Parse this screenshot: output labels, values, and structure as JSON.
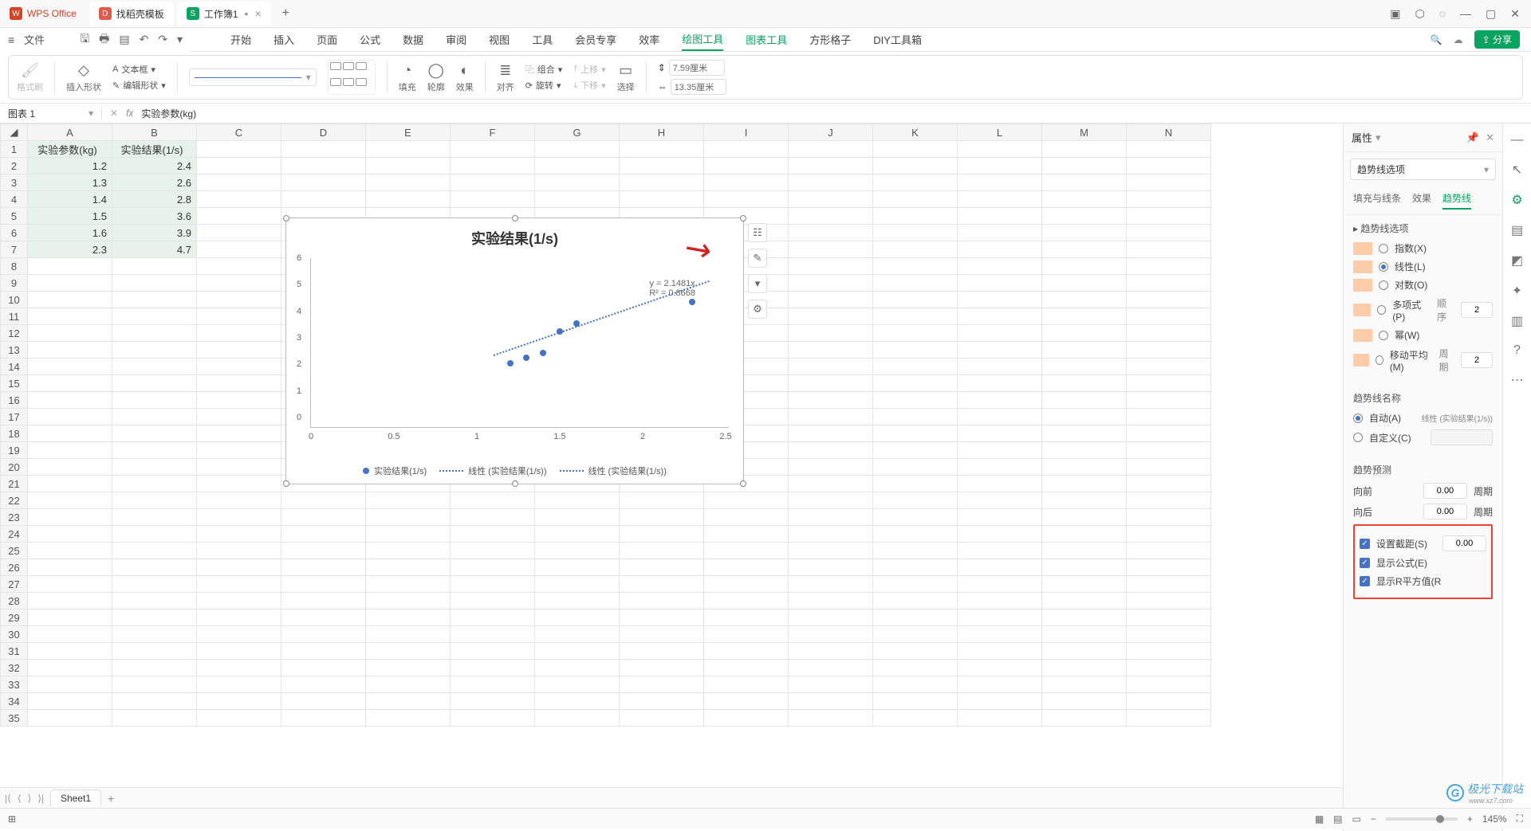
{
  "app": {
    "name": "WPS Office",
    "template_tab": "找稻壳模板",
    "doc_tab": "工作簿1"
  },
  "window_controls": {
    "min": "—",
    "max": "▢",
    "close": "✕"
  },
  "file_menu": "文件",
  "ribbon_tabs": [
    "开始",
    "插入",
    "页面",
    "公式",
    "数据",
    "审阅",
    "视图",
    "工具",
    "会员专享",
    "效率",
    "绘图工具",
    "图表工具",
    "方形格子",
    "DIY工具箱"
  ],
  "ribbon_tabs_active": "绘图工具",
  "ribbon_tabs_special": "图表工具",
  "toolbar": {
    "format_brush": "格式刷",
    "insert_shape": "插入形状",
    "text_box": "文本框",
    "edit_shape": "编辑形状",
    "fill": "填充",
    "outline": "轮廓",
    "effect": "效果",
    "align": "对齐",
    "group": "组合",
    "rotate": "旋转",
    "move_up": "上移",
    "move_down": "下移",
    "select": "选择",
    "width": "7.59厘米",
    "height": "13.35厘米"
  },
  "namebox": "图表 1",
  "formula": "实验参数(kg)",
  "columns": [
    "A",
    "B",
    "C",
    "D",
    "E",
    "F",
    "G",
    "H",
    "I",
    "J",
    "K",
    "L",
    "M",
    "N"
  ],
  "rows_count": 35,
  "data_table": {
    "headers": [
      "实验参数(kg)",
      "实验结果(1/s)"
    ],
    "rows": [
      [
        "1.2",
        "2.4"
      ],
      [
        "1.3",
        "2.6"
      ],
      [
        "1.4",
        "2.8"
      ],
      [
        "1.5",
        "3.6"
      ],
      [
        "1.6",
        "3.9"
      ],
      [
        "2.3",
        "4.7"
      ]
    ]
  },
  "chart_data": {
    "type": "scatter",
    "title": "实验结果(1/s)",
    "x": [
      1.2,
      1.3,
      1.4,
      1.5,
      1.6,
      2.3
    ],
    "y": [
      2.4,
      2.6,
      2.8,
      3.6,
      3.9,
      4.7
    ],
    "xlim": [
      0,
      2.5
    ],
    "ylim": [
      0,
      6
    ],
    "x_ticks": [
      0,
      0.5,
      1,
      1.5,
      2,
      2.5
    ],
    "y_ticks": [
      0,
      1,
      2,
      3,
      4,
      5,
      6
    ],
    "trendline": {
      "type": "linear",
      "equation": "y = 2.1481x",
      "r2": "R² = 0.8668"
    },
    "legend": [
      "实验结果(1/s)",
      "线性 (实验结果(1/s))",
      "线性 (实验结果(1/s))"
    ]
  },
  "panel": {
    "title": "属性",
    "selector": "趋势线选项",
    "tabs": [
      "填充与线条",
      "效果",
      "趋势线"
    ],
    "tab_active": "趋势线",
    "section_options": "趋势线选项",
    "types": [
      {
        "label": "指数(X)",
        "checked": false
      },
      {
        "label": "线性(L)",
        "checked": true
      },
      {
        "label": "对数(O)",
        "checked": false
      },
      {
        "label": "多项式(P)",
        "checked": false,
        "extra_label": "顺序",
        "extra_val": "2"
      },
      {
        "label": "幂(W)",
        "checked": false
      },
      {
        "label": "移动平均(M)",
        "checked": false,
        "extra_label": "周期",
        "extra_val": "2"
      }
    ],
    "name_section": "趋势线名称",
    "name_auto": "自动(A)",
    "name_auto_val": "线性 (实验结果(1/s))",
    "name_custom": "自定义(C)",
    "forecast_section": "趋势预测",
    "forward": "向前",
    "forward_val": "0.00",
    "period_label": "周期",
    "backward": "向后",
    "backward_val": "0.00",
    "checks": [
      {
        "label": "设置截距(S)",
        "val": "0.00"
      },
      {
        "label": "显示公式(E)"
      },
      {
        "label": "显示R平方值(R"
      }
    ]
  },
  "sheet_tab": "Sheet1",
  "zoom": "145%",
  "share": "分享",
  "watermark": {
    "brand": "极光下载站",
    "url": "www.xz7.com"
  }
}
